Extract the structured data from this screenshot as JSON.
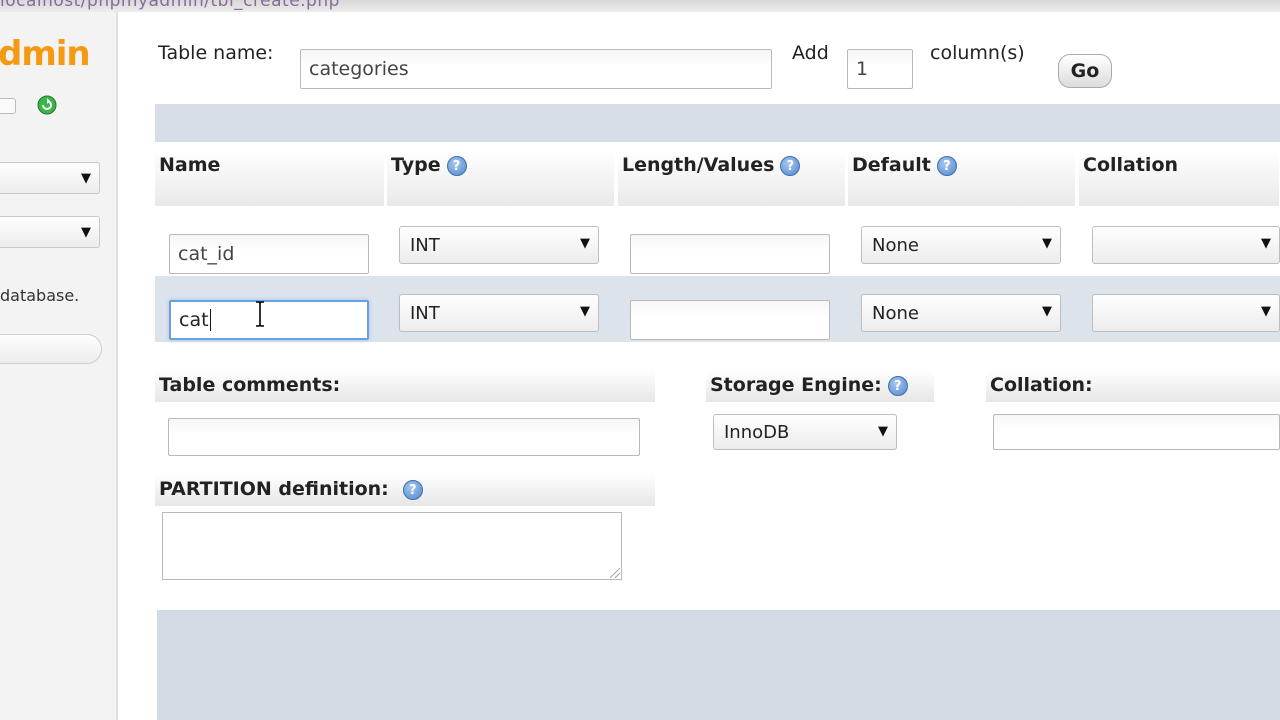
{
  "breadcrumb": "localhost/phpmyadmin/tbl_create.php",
  "sidebar": {
    "logo_text": "dmin",
    "db_hint": "database."
  },
  "form": {
    "table_name_label": "Table name:",
    "table_name_value": "categories",
    "add_label": "Add",
    "add_count": "1",
    "columns_label": "column(s)",
    "go_label": "Go"
  },
  "columns": {
    "headers": {
      "name": "Name",
      "type": "Type",
      "length": "Length/Values",
      "default": "Default",
      "collation": "Collation"
    },
    "rows": [
      {
        "name": "cat_id",
        "type": "INT",
        "length": "",
        "default": "None",
        "collation": ""
      },
      {
        "name": "cat",
        "type": "INT",
        "length": "",
        "default": "None",
        "collation": ""
      }
    ]
  },
  "table_comments": {
    "label": "Table comments:",
    "value": ""
  },
  "storage_engine": {
    "label": "Storage Engine:",
    "value": "InnoDB"
  },
  "collation": {
    "label": "Collation:",
    "value": ""
  },
  "partition": {
    "label": "PARTITION definition:",
    "value": ""
  },
  "colors": {
    "logo": "#f49a10",
    "header_bar": "#d6dde6",
    "row_alt": "#dde3eb",
    "focus": "#6aa0e0"
  }
}
